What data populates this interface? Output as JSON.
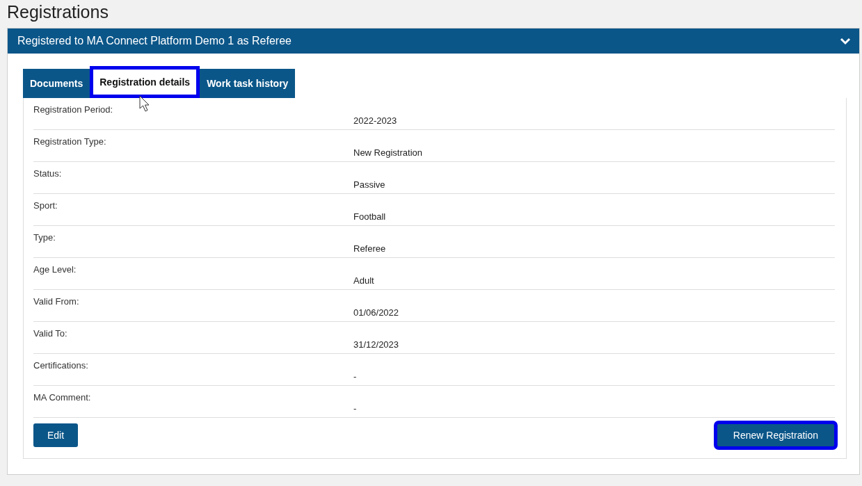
{
  "page_title": "Registrations",
  "panel": {
    "title": "Registered to MA Connect Platform Demo 1 as Referee",
    "expanded": true
  },
  "tabs": [
    {
      "label": "Documents",
      "selected": false,
      "highlighted": false
    },
    {
      "label": "Registration details",
      "selected": true,
      "highlighted": true
    },
    {
      "label": "Work task history",
      "selected": false,
      "highlighted": false
    }
  ],
  "details": [
    {
      "label": "Registration Period:",
      "value": "2022-2023"
    },
    {
      "label": "Registration Type:",
      "value": "New Registration"
    },
    {
      "label": "Status:",
      "value": "Passive"
    },
    {
      "label": "Sport:",
      "value": "Football"
    },
    {
      "label": "Type:",
      "value": "Referee"
    },
    {
      "label": "Age Level:",
      "value": "Adult"
    },
    {
      "label": "Valid From:",
      "value": "01/06/2022"
    },
    {
      "label": "Valid To:",
      "value": "31/12/2023"
    },
    {
      "label": "Certifications:",
      "value": "-"
    },
    {
      "label": "MA Comment:",
      "value": "-"
    }
  ],
  "buttons": [
    {
      "label": "Edit",
      "highlighted": false
    },
    {
      "label": "Renew Registration",
      "highlighted": true
    }
  ]
}
